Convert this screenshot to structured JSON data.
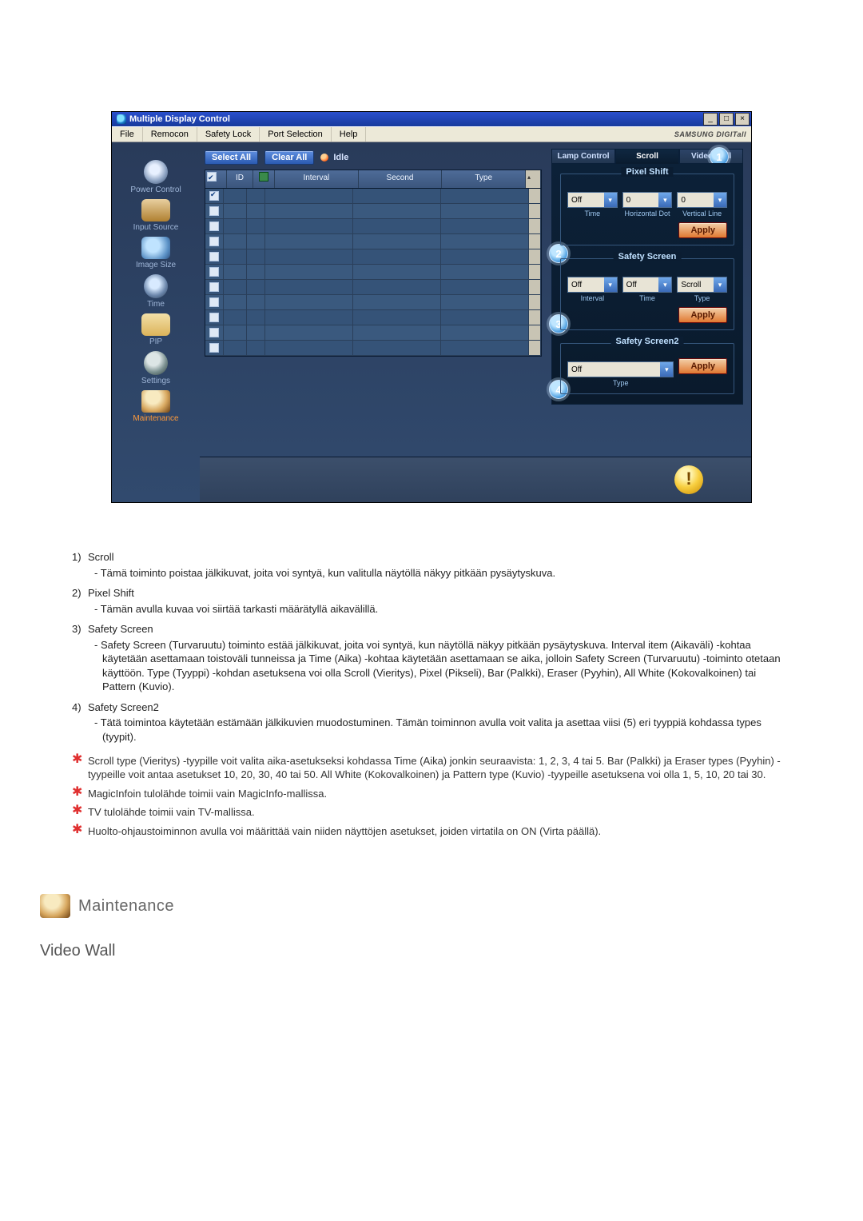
{
  "app": {
    "title": "Multiple Display Control",
    "brand": "SAMSUNG DIGITall"
  },
  "menu": {
    "file": "File",
    "remocon": "Remocon",
    "safety_lock": "Safety Lock",
    "port_selection": "Port Selection",
    "help": "Help"
  },
  "sidebar": {
    "items": [
      {
        "label": "Power Control"
      },
      {
        "label": "Input Source"
      },
      {
        "label": "Image Size"
      },
      {
        "label": "Time"
      },
      {
        "label": "PIP"
      },
      {
        "label": "Settings"
      },
      {
        "label": "Maintenance"
      }
    ]
  },
  "toolbar": {
    "select_all": "Select All",
    "clear_all": "Clear All",
    "idle": "Idle"
  },
  "grid": {
    "headers": {
      "id": "ID",
      "interval": "Interval",
      "second": "Second",
      "type": "Type"
    },
    "rows": [
      {
        "checked": true
      },
      {
        "checked": false
      },
      {
        "checked": false
      },
      {
        "checked": false
      },
      {
        "checked": false
      },
      {
        "checked": false
      },
      {
        "checked": false
      },
      {
        "checked": false
      },
      {
        "checked": false
      },
      {
        "checked": false
      },
      {
        "checked": false
      }
    ]
  },
  "tabs": {
    "lamp": "Lamp Control",
    "scroll": "Scroll",
    "videowall": "Video Wall"
  },
  "panel": {
    "pixel_shift": {
      "legend": "Pixel Shift",
      "time_value": "Off",
      "time_label": "Time",
      "hdot_value": "0",
      "hdot_label": "Horizontal Dot",
      "vline_value": "0",
      "vline_label": "Vertical Line",
      "apply": "Apply"
    },
    "safety_screen": {
      "legend": "Safety Screen",
      "interval_value": "Off",
      "interval_label": "Interval",
      "time_value": "Off",
      "time_label": "Time",
      "type_value": "Scroll",
      "type_label": "Type",
      "apply": "Apply"
    },
    "safety_screen2": {
      "legend": "Safety Screen2",
      "type_value": "Off",
      "type_label": "Type",
      "apply": "Apply"
    }
  },
  "callouts": {
    "c1": "1",
    "c2": "2",
    "c3": "3",
    "c4": "4"
  },
  "doc": {
    "item1_num": "1)",
    "item1_title": "Scroll",
    "item1_text": "- Tämä toiminto poistaa jälkikuvat, joita voi syntyä, kun valitulla näytöllä näkyy pitkään pysäytyskuva.",
    "item2_num": "2)",
    "item2_title": "Pixel Shift",
    "item2_text": "- Tämän avulla kuvaa voi siirtää tarkasti määrätyllä aikavälillä.",
    "item3_num": "3)",
    "item3_title": "Safety Screen",
    "item3_text": "- Safety Screen (Turvaruutu) toiminto estää jälkikuvat, joita voi syntyä, kun näytöllä näkyy pitkään pysäytyskuva. Interval item (Aikaväli) -kohtaa käytetään asettamaan toistoväli tunneissa ja Time (Aika) -kohtaa käytetään asettamaan se aika, jolloin Safety Screen (Turvaruutu) -toiminto otetaan käyttöön. Type (Tyyppi) -kohdan asetuksena voi olla Scroll (Vieritys), Pixel (Pikseli), Bar (Palkki), Eraser (Pyyhin), All White (Kokovalkoinen) tai Pattern (Kuvio).",
    "item4_num": "4)",
    "item4_title": "Safety Screen2",
    "item4_text": "- Tätä toimintoa käytetään estämään jälkikuvien muodostuminen. Tämän toiminnon avulla voit valita ja asettaa viisi (5) eri tyyppiä kohdassa types (tyypit).",
    "star1": "Scroll type (Vieritys) -tyypille voit valita aika-asetukseksi kohdassa Time (Aika) jonkin seuraavista: 1, 2, 3, 4 tai 5. Bar (Palkki) ja Eraser types (Pyyhin) -tyypeille voit antaa asetukset 10, 20, 30, 40 tai 50. All White (Kokovalkoinen) ja Pattern type (Kuvio) -tyypeille asetuksena voi olla 1, 5, 10, 20 tai 30.",
    "star2": "MagicInfoin tulolähde toimii vain MagicInfo-mallissa.",
    "star3": "TV tulolähde toimii vain TV-mallissa.",
    "star4": "Huolto-ohjaustoiminnon avulla voi määrittää vain niiden näyttöjen asetukset, joiden virtatila on ON (Virta päällä)."
  },
  "headings": {
    "maintenance": "Maintenance",
    "video_wall": "Video Wall"
  }
}
